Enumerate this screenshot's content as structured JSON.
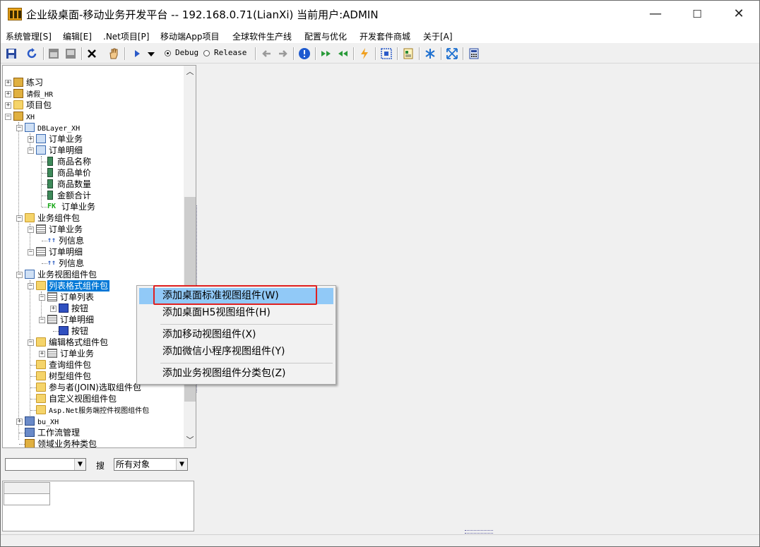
{
  "window": {
    "title": "企业级桌面-移动业务开发平台 -- 192.168.0.71(LianXi) 当前用户:ADMIN",
    "controls": {
      "minimize": "—",
      "maximize": "☐",
      "close": "✕"
    }
  },
  "menu": [
    "系统管理[S]",
    "编辑[E]",
    ".Net项目[P]",
    "移动端App项目",
    "全球软件生产线",
    "配置与优化",
    "开发套件商城",
    "关于[A]"
  ],
  "toolbar": {
    "debug_label": "Debug",
    "release_label": "Release",
    "selected_mode": "Debug",
    "icons": [
      "save-icon",
      "refresh-icon",
      "window-up-icon",
      "window-down-icon",
      "delete-icon",
      "hand-icon",
      "run-icon",
      "dropdown-arrow-icon",
      "back-arrow-icon",
      "forward-arrow-icon",
      "info-icon",
      "double-right-icon",
      "double-left-icon",
      "lightning-icon",
      "select-area-icon",
      "document-icon",
      "snowflake-icon",
      "expand-icon",
      "calculator-icon"
    ]
  },
  "tree": {
    "nodes": [
      {
        "label": "练习"
      },
      {
        "label": "请假_HR"
      },
      {
        "label": "项目包"
      },
      {
        "label": "XH"
      },
      {
        "label": "DBLayer_XH"
      },
      {
        "label": "订单业务"
      },
      {
        "label": "订单明细"
      },
      {
        "label": "商品名称"
      },
      {
        "label": "商品单价"
      },
      {
        "label": "商品数量"
      },
      {
        "label": "金额合计"
      },
      {
        "label": "订单业务",
        "badge": "FK"
      },
      {
        "label": "业务组件包"
      },
      {
        "label": "订单业务"
      },
      {
        "label": "列信息"
      },
      {
        "label": "订单明细"
      },
      {
        "label": "列信息"
      },
      {
        "label": "业务视图组件包"
      },
      {
        "label": "列表格式组件包"
      },
      {
        "label": "订单列表"
      },
      {
        "label": "按钮"
      },
      {
        "label": "订单明细"
      },
      {
        "label": "按钮"
      },
      {
        "label": "编辑格式组件包"
      },
      {
        "label": "订单业务"
      },
      {
        "label": "查询组件包"
      },
      {
        "label": "树型组件包"
      },
      {
        "label": "参与者(JOIN)选取组件包"
      },
      {
        "label": "自定义视图组件包"
      },
      {
        "label": "Asp.Net服务端控件视图组件包"
      },
      {
        "label": "bu_XH"
      },
      {
        "label": "工作流管理"
      },
      {
        "label": "领域业务种类包"
      }
    ],
    "selected": "列表格式组件包"
  },
  "search": {
    "left_combo_value": "",
    "label": "搜",
    "scope_value": "所有对象"
  },
  "context_menu": {
    "items": [
      "添加桌面标准视图组件(W)",
      "添加桌面H5视图组件(H)",
      "添加移动视图组件(X)",
      "添加微信小程序视图组件(Y)",
      "添加业务视图组件分类包(Z)"
    ],
    "highlighted": "添加桌面标准视图组件(W)"
  },
  "colors": {
    "selection": "#0078d7",
    "menu_highlight": "#91c9f7",
    "annotation_box": "#e02020"
  }
}
